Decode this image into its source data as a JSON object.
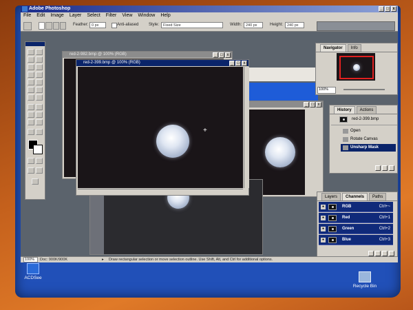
{
  "app": {
    "title": "Adobe Photoshop"
  },
  "menu": [
    "File",
    "Edit",
    "Image",
    "Layer",
    "Select",
    "Filter",
    "View",
    "Window",
    "Help"
  ],
  "options": {
    "feather_label": "Feather:",
    "feather_value": "0 px",
    "antialiased_label": "Anti-aliased",
    "style_label": "Style:",
    "style_value": "Fixed Size",
    "width_label": "Width:",
    "width_value": "240 px",
    "height_label": "Height:",
    "height_value": "240 px"
  },
  "documents": {
    "back": {
      "title": "red-2-982.bmp @ 100% (RGB)"
    },
    "front": {
      "title": "red-2-399.bmp @ 100% (RGB)"
    }
  },
  "navigator": {
    "tabs": [
      "Navigator",
      "Info"
    ],
    "zoom": "100%"
  },
  "history": {
    "tabs": [
      "History",
      "Actions"
    ],
    "snapshot": "red-2-399.bmp",
    "items": [
      "Open",
      "Rotate Canvas",
      "Unsharp Mask"
    ]
  },
  "channels": {
    "tabs": [
      "Layers",
      "Channels",
      "Paths"
    ],
    "rows": [
      {
        "name": "RGB",
        "shortcut": "Ctrl+~"
      },
      {
        "name": "Red",
        "shortcut": "Ctrl+1"
      },
      {
        "name": "Green",
        "shortcut": "Ctrl+2"
      },
      {
        "name": "Blue",
        "shortcut": "Ctrl+3"
      }
    ]
  },
  "status": {
    "zoom": "100%",
    "doc": "Doc: 900K/900K",
    "hint": "Draw rectangular selection or move selection outline. Use Shift, Alt, and Ctrl for additional options."
  },
  "desktop": {
    "acdsee": "ACDSee",
    "recycle": "Recycle Bin"
  }
}
